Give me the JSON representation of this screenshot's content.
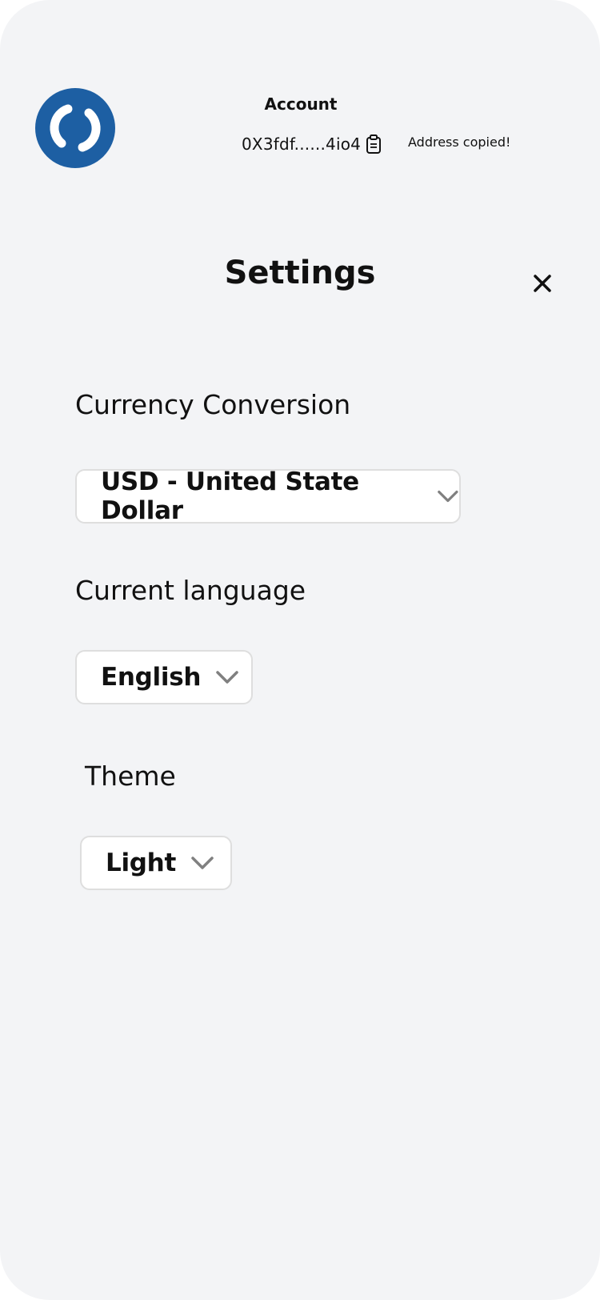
{
  "header": {
    "account_title": "Account",
    "address": "0X3fdf......4io4",
    "copied_message": "Address copied!"
  },
  "page": {
    "title": "Settings"
  },
  "settings": {
    "currency": {
      "label": "Currency Conversion",
      "value": "USD - United State Dollar"
    },
    "language": {
      "label": "Current language",
      "value": "English"
    },
    "theme": {
      "label": "Theme",
      "value": "Light"
    }
  },
  "colors": {
    "background": "#f3f4f6",
    "logo_blue": "#1d5fa3",
    "select_bg": "#ffffff",
    "chevron": "#808080"
  }
}
